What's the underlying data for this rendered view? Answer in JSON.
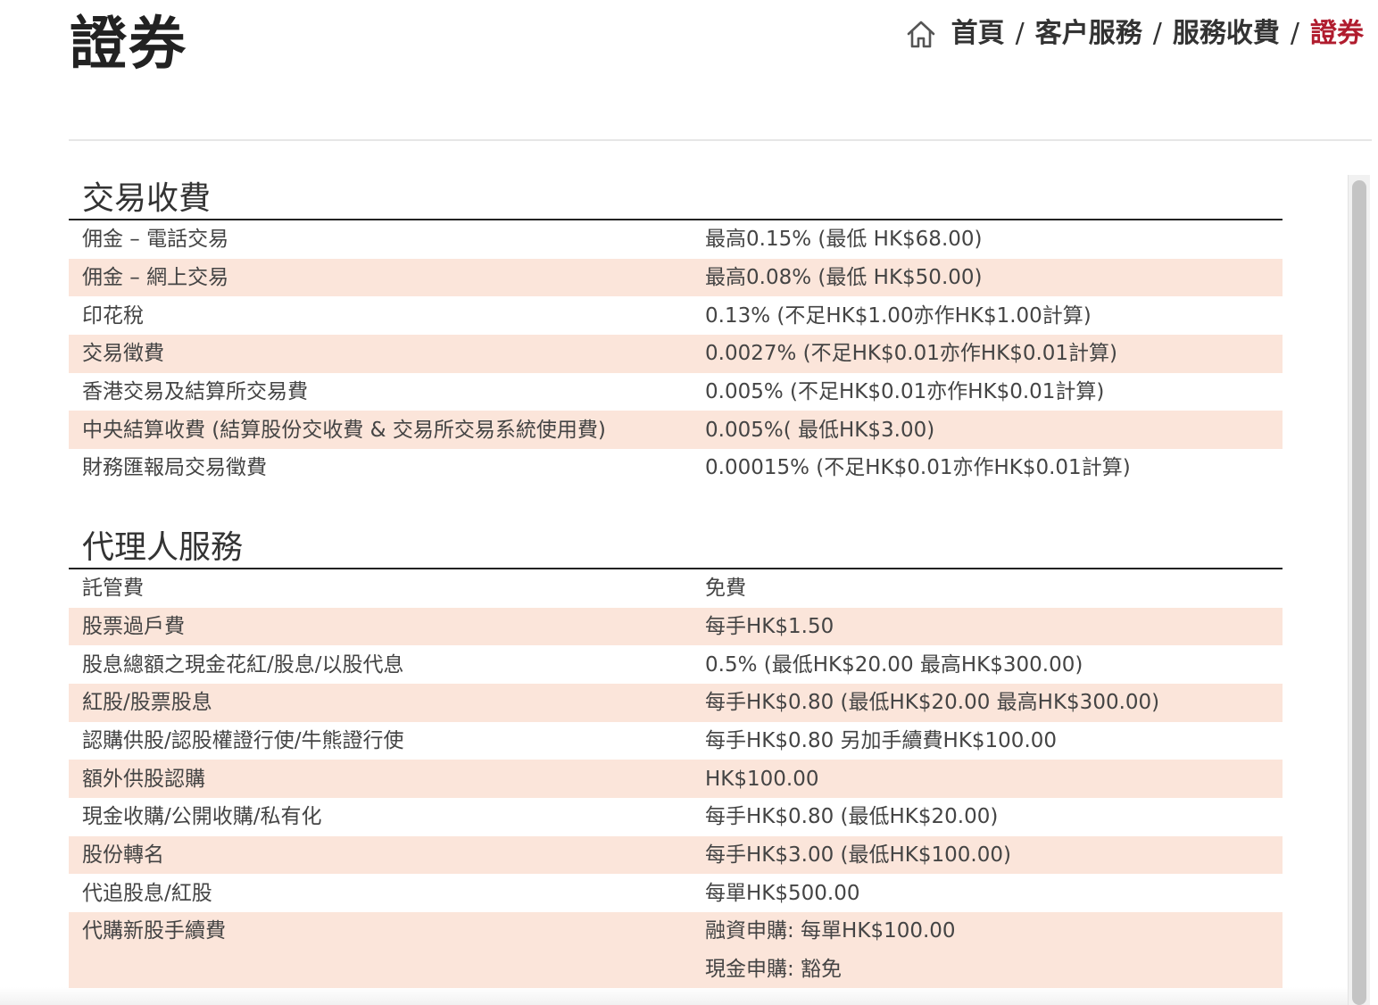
{
  "header": {
    "title": "證券",
    "breadcrumb": {
      "home": "首頁",
      "separator": "/",
      "customer_service": "客户服務",
      "service_fees": "服務收費",
      "current": "證券"
    }
  },
  "colors": {
    "accent": "#b01c2e",
    "row_stripe": "#fbe5da",
    "section_rule": "#222222"
  },
  "sections": [
    {
      "title": "交易收費",
      "rows": [
        {
          "item": "佣金 – 電話交易",
          "fee": [
            "最高0.15% (最低  HK$68.00)"
          ]
        },
        {
          "item": "佣金 – 網上交易",
          "fee": [
            "最高0.08% (最低  HK$50.00)"
          ]
        },
        {
          "item": "印花稅",
          "fee": [
            "0.13% (不足HK$1.00亦作HK$1.00計算)"
          ]
        },
        {
          "item": "交易徵費",
          "fee": [
            "0.0027% (不足HK$0.01亦作HK$0.01計算)"
          ]
        },
        {
          "item": "香港交易及結算所交易費",
          "fee": [
            "0.005% (不足HK$0.01亦作HK$0.01計算)"
          ]
        },
        {
          "item": "中央結算收費 (結算股份交收費 & 交易所交易系統使用費)",
          "fee": [
            "0.005%( 最低HK$3.00)"
          ]
        },
        {
          "item": "財務匯報局交易徵費",
          "fee": [
            "0.00015% (不足HK$0.01亦作HK$0.01計算)"
          ]
        }
      ]
    },
    {
      "title": "代理人服務",
      "rows": [
        {
          "item": "託管費",
          "fee": [
            "免費"
          ]
        },
        {
          "item": "股票過戶費",
          "fee": [
            "每手HK$1.50"
          ]
        },
        {
          "item": "股息總額之現金花紅/股息/以股代息",
          "fee": [
            "0.5% (最低HK$20.00 最高HK$300.00)"
          ]
        },
        {
          "item": "紅股/股票股息",
          "fee": [
            "每手HK$0.80 (最低HK$20.00 最高HK$300.00)"
          ]
        },
        {
          "item": "認購供股/認股權證行使/牛熊證行使",
          "fee": [
            "每手HK$0.80 另加手續費HK$100.00"
          ]
        },
        {
          "item": "額外供股認購",
          "fee": [
            "HK$100.00"
          ]
        },
        {
          "item": "現金收購/公開收購/私有化",
          "fee": [
            "每手HK$0.80 (最低HK$20.00)"
          ]
        },
        {
          "item": "股份轉名",
          "fee": [
            "每手HK$3.00 (最低HK$100.00)"
          ]
        },
        {
          "item": "代追股息/紅股",
          "fee": [
            "每單HK$500.00"
          ]
        },
        {
          "item": "代購新股手續費",
          "fee": [
            "融資申購: 每單HK$100.00",
            "現金申購:  豁免"
          ]
        }
      ]
    }
  ]
}
